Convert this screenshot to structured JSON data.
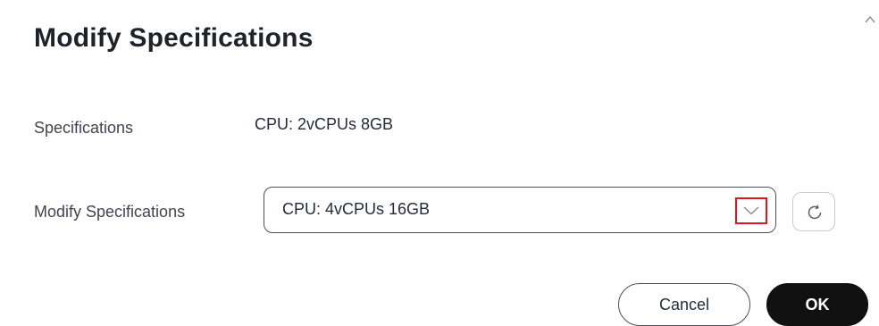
{
  "dialog": {
    "title": "Modify Specifications",
    "current_spec": {
      "label": "Specifications",
      "value": "CPU: 2vCPUs 8GB"
    },
    "modify_spec": {
      "label": "Modify Specifications",
      "selected_value": "CPU: 4vCPUs 16GB"
    },
    "buttons": {
      "cancel_label": "Cancel",
      "ok_label": "OK"
    },
    "icons": {
      "collapse": "chevron-up-icon",
      "dropdown": "chevron-down-icon",
      "refresh": "refresh-icon"
    },
    "colors": {
      "highlight": "#e0161f",
      "primary_button": "#111111"
    }
  }
}
